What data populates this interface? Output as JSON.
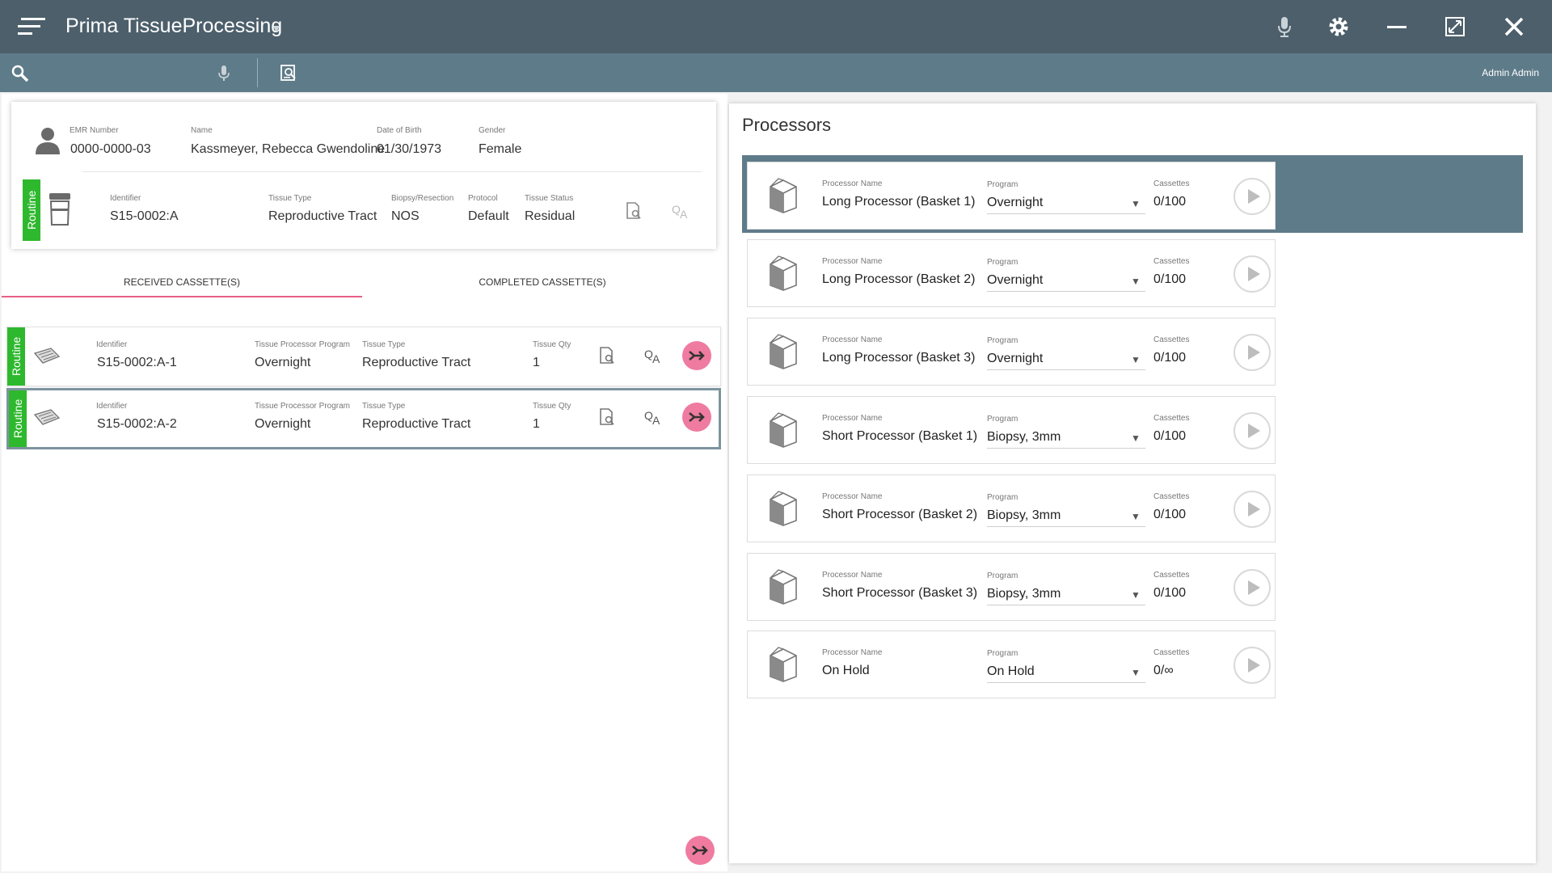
{
  "app": {
    "title": "Prima TissueProcessing",
    "user": "Admin Admin"
  },
  "colors": {
    "titlebar": "#4c5f6b",
    "toolbar": "#5e7b89",
    "routine": "#2eb82e",
    "accent_pink": "#ef7ba0",
    "tab_underline": "#e95f87"
  },
  "icons": {
    "menu": "menu-icon",
    "microphone": "microphone-icon",
    "settings": "gear-icon",
    "minimize": "minimize-icon",
    "maximize": "maximize-icon",
    "close": "close-icon",
    "search": "search-icon",
    "scan": "scan-icon"
  },
  "patient": {
    "emr_label": "EMR Number",
    "emr": "0000-0000-03",
    "name_label": "Name",
    "name": "Kassmeyer, Rebecca Gwendoline",
    "dob_label": "Date of Birth",
    "dob": "01/30/1973",
    "gender_label": "Gender",
    "gender": "Female"
  },
  "specimen": {
    "priority": "Routine",
    "identifier_label": "Identifier",
    "identifier": "S15-0002:A",
    "tissue_type_label": "Tissue Type",
    "tissue_type": "Reproductive Tract",
    "biopsy_label": "Biopsy/Resection",
    "biopsy": "NOS",
    "protocol_label": "Protocol",
    "protocol": "Default",
    "status_label": "Tissue Status",
    "status": "Residual"
  },
  "tabs": {
    "received": "RECEIVED CASSETTE(S)",
    "completed": "COMPLETED CASSETTE(S)"
  },
  "cassette_labels": {
    "identifier": "Identifier",
    "program": "Tissue Processor Program",
    "tissue_type": "Tissue Type",
    "qty": "Tissue Qty"
  },
  "cassettes": [
    {
      "priority": "Routine",
      "identifier": "S15-0002:A-1",
      "program": "Overnight",
      "tissue_type": "Reproductive Tract",
      "qty": "1"
    },
    {
      "priority": "Routine",
      "identifier": "S15-0002:A-2",
      "program": "Overnight",
      "tissue_type": "Reproductive Tract",
      "qty": "1"
    }
  ],
  "processors_panel": {
    "heading": "Processors",
    "name_label": "Processor Name",
    "program_label": "Program",
    "cassettes_label": "Cassettes"
  },
  "processors": [
    {
      "name": "Long Processor (Basket 1)",
      "program": "Overnight",
      "cassettes": "0/100"
    },
    {
      "name": "Long Processor (Basket 2)",
      "program": "Overnight",
      "cassettes": "0/100"
    },
    {
      "name": "Long Processor (Basket 3)",
      "program": "Overnight",
      "cassettes": "0/100"
    },
    {
      "name": "Short Processor (Basket 1)",
      "program": "Biopsy, 3mm",
      "cassettes": "0/100"
    },
    {
      "name": "Short Processor (Basket 2)",
      "program": "Biopsy, 3mm",
      "cassettes": "0/100"
    },
    {
      "name": "Short Processor (Basket 3)",
      "program": "Biopsy, 3mm",
      "cassettes": "0/100"
    },
    {
      "name": "On Hold",
      "program": "On Hold",
      "cassettes": "0/∞"
    }
  ]
}
